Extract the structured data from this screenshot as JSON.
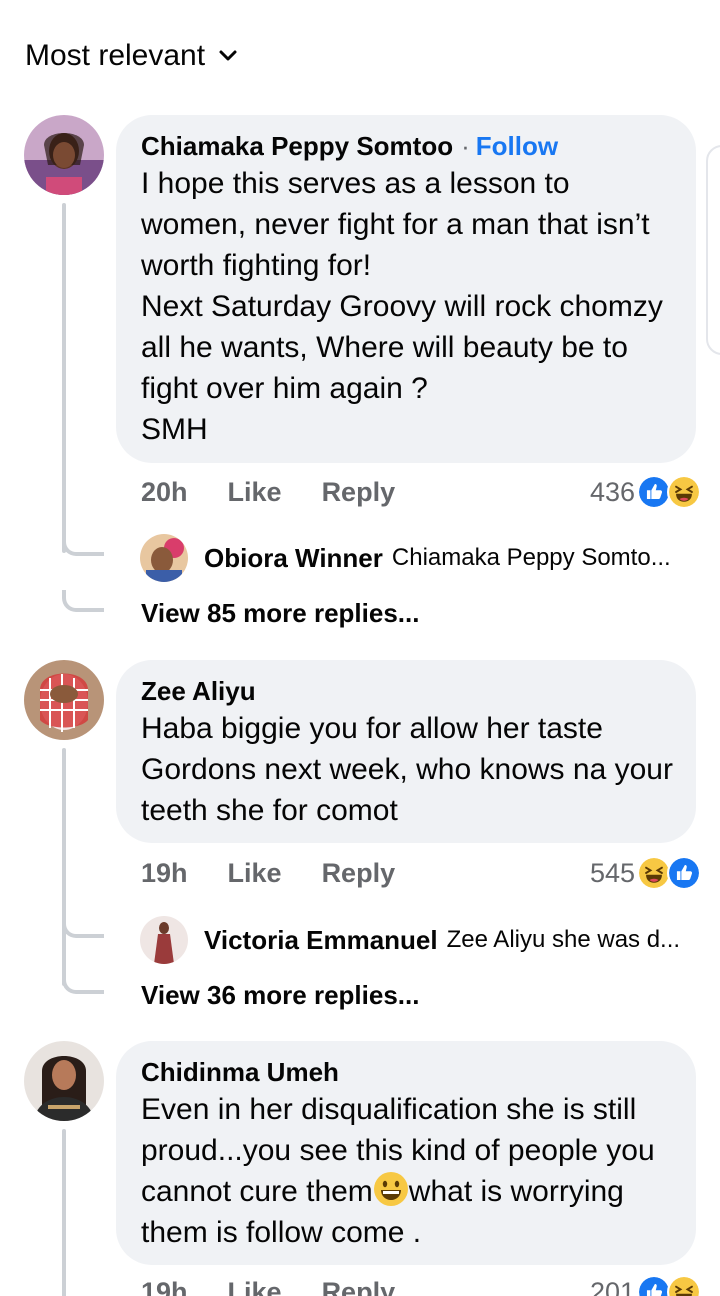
{
  "sort": {
    "label": "Most relevant",
    "icon": "chevron-down-icon"
  },
  "colors": {
    "accent": "#1877f2",
    "bubble": "#f0f2f5",
    "meta": "#65676b",
    "thread_line": "#ccd0d5"
  },
  "comments": [
    {
      "author": "Chiamaka Peppy Somtoo",
      "follow_label": "Follow",
      "text": "I hope this serves as a lesson to women, never fight for a man that isn’t worth fighting for!\nNext Saturday Groovy will rock chomzy all he wants, Where will beauty be to fight over him again ?\nSMH",
      "time": "20h",
      "like_label": "Like",
      "reply_label": "Reply",
      "reaction_count": "436",
      "reactions": [
        "like-icon",
        "haha-icon"
      ],
      "reply_preview": {
        "name": "Obiora Winner",
        "snippet": "Chiamaka Peppy Somto..."
      },
      "view_more": "View 85 more replies..."
    },
    {
      "author": "Zee Aliyu",
      "text": "Haba biggie you for allow her taste Gordons next week, who knows na your teeth she for comot",
      "time": "19h",
      "like_label": "Like",
      "reply_label": "Reply",
      "reaction_count": "545",
      "reactions": [
        "haha-icon",
        "like-icon"
      ],
      "reply_preview": {
        "name": "Victoria Emmanuel",
        "snippet": "Zee Aliyu she was d..."
      },
      "view_more": "View 36 more replies..."
    },
    {
      "author": "Chidinma Umeh",
      "text_before_emoji": "Even in her disqualification she is still proud...you see this kind of people you cannot cure them",
      "text_after_emoji": "what is worrying them is follow come .",
      "inline_emoji": "smile-emoji-icon",
      "time": "19h",
      "like_label": "Like",
      "reply_label": "Reply",
      "reaction_count": "201",
      "reactions": [
        "like-icon",
        "haha-icon"
      ]
    }
  ]
}
